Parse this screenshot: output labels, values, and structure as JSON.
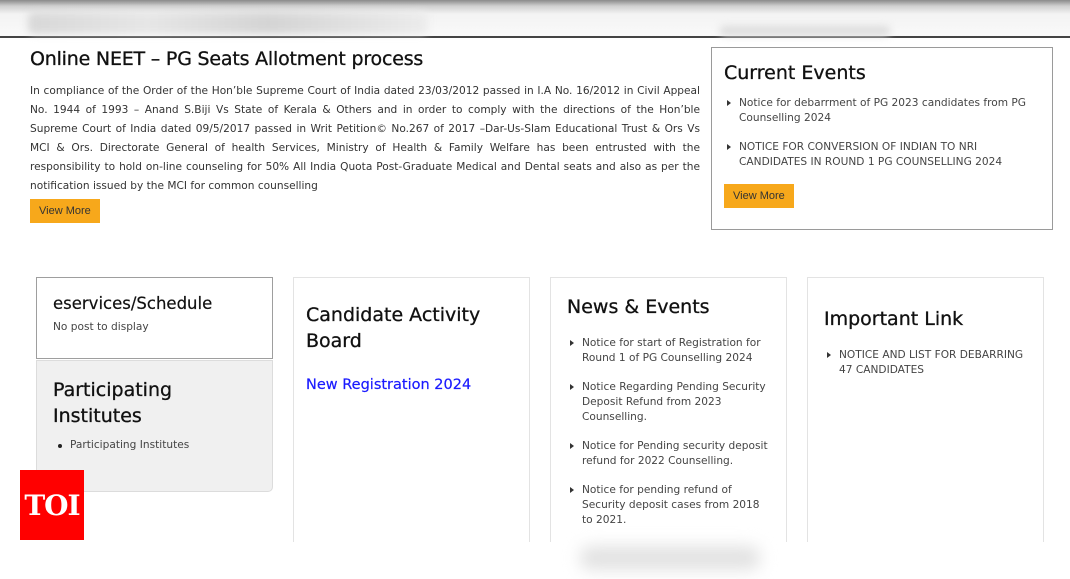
{
  "intro": {
    "title": "Online NEET – PG Seats Allotment process",
    "body": "In compliance of the Order of the Hon’ble Supreme Court of India dated 23/03/2012 passed in I.A No. 16/2012 in Civil Appeal No. 1944 of 1993 – Anand S.Biji Vs State of Kerala & Others and in order to comply with the directions of the Hon’ble Supreme Court of India dated 09/5/2017 passed in Writ Petition© No.267 of 2017 –Dar-Us-Slam Educational Trust & Ors Vs MCI & Ors. Directorate General of health Services, Ministry of Health & Family Welfare has been entrusted with the responsibility to hold on-line counseling for 50% All India Quota Post-Graduate Medical and Dental seats and also as per the notification issued by the MCI for common counselling",
    "view_more_label": "View More"
  },
  "current_events": {
    "title": "Current Events",
    "items": [
      "Notice for debarrment of PG 2023 candidates from PG Counselling 2024",
      "NOTICE FOR CONVERSION OF INDIAN TO NRI CANDIDATES IN ROUND 1 PG COUNSELLING 2024"
    ],
    "view_more_label": "View More"
  },
  "eservices": {
    "title": "eservices/Schedule",
    "empty_text": "No post to display"
  },
  "participating": {
    "title": "Participating Institutes",
    "items": [
      "Participating Institutes"
    ]
  },
  "activity_board": {
    "title": "Candidate Activity Board",
    "link_label": "New Registration 2024",
    "link_color": "#1a1aff"
  },
  "news_events": {
    "title": "News & Events",
    "items": [
      "Notice for start of Registration for Round 1 of PG Counselling 2024",
      "Notice Regarding Pending Security Deposit Refund from 2023 Counselling.",
      "Notice for Pending security deposit refund for 2022 Counselling.",
      "Notice for pending refund of Security deposit cases from 2018 to 2021."
    ]
  },
  "important_link": {
    "title": "Important Link",
    "items": [
      "NOTICE AND LIST FOR DEBARRING 47 CANDIDATES"
    ]
  },
  "watermark": {
    "text": "TOI",
    "color": "#ff0000"
  },
  "colors": {
    "button_bg": "#f7a81b"
  }
}
